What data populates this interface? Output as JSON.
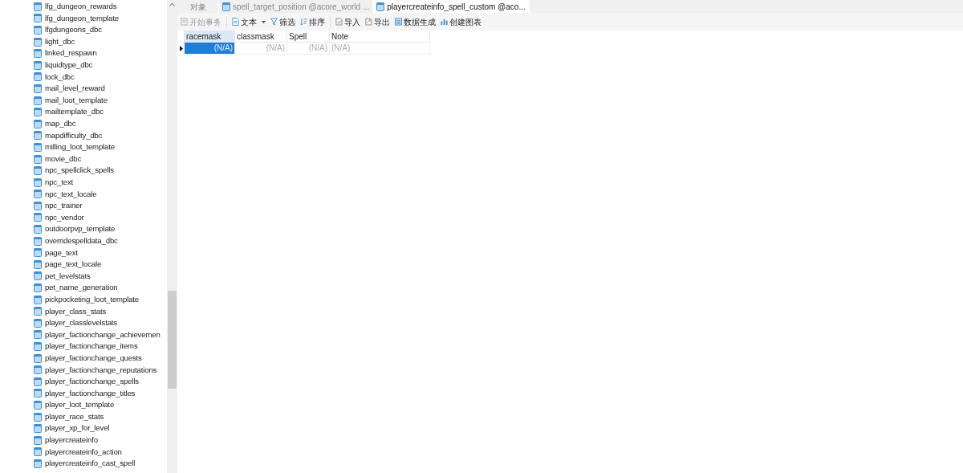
{
  "sidebar": {
    "items": [
      {
        "label": "lfg_dungeon_rewards"
      },
      {
        "label": "lfg_dungeon_template"
      },
      {
        "label": "lfgdungeons_dbc"
      },
      {
        "label": "light_dbc"
      },
      {
        "label": "linked_respawn"
      },
      {
        "label": "liquidtype_dbc"
      },
      {
        "label": "lock_dbc"
      },
      {
        "label": "mail_level_reward"
      },
      {
        "label": "mail_loot_template"
      },
      {
        "label": "mailtemplate_dbc"
      },
      {
        "label": "map_dbc"
      },
      {
        "label": "mapdifficulty_dbc"
      },
      {
        "label": "milling_loot_template"
      },
      {
        "label": "movie_dbc"
      },
      {
        "label": "npc_spellclick_spells"
      },
      {
        "label": "npc_text"
      },
      {
        "label": "npc_text_locale"
      },
      {
        "label": "npc_trainer"
      },
      {
        "label": "npc_vendor"
      },
      {
        "label": "outdoorpvp_template"
      },
      {
        "label": "overridespelldata_dbc"
      },
      {
        "label": "page_text"
      },
      {
        "label": "page_text_locale"
      },
      {
        "label": "pet_levelstats"
      },
      {
        "label": "pet_name_generation"
      },
      {
        "label": "pickpocketing_loot_template"
      },
      {
        "label": "player_class_stats"
      },
      {
        "label": "player_classlevelstats"
      },
      {
        "label": "player_factionchange_achievemen"
      },
      {
        "label": "player_factionchange_items"
      },
      {
        "label": "player_factionchange_quests"
      },
      {
        "label": "player_factionchange_reputations"
      },
      {
        "label": "player_factionchange_spells"
      },
      {
        "label": "player_factionchange_titles"
      },
      {
        "label": "player_loot_template"
      },
      {
        "label": "player_race_stats"
      },
      {
        "label": "player_xp_for_level"
      },
      {
        "label": "playercreateinfo"
      },
      {
        "label": "playercreateinfo_action"
      },
      {
        "label": "playercreateinfo_cast_spell"
      }
    ]
  },
  "tabs": [
    {
      "label": "对象",
      "kind": "plain",
      "selected": false
    },
    {
      "label": "spell_target_position @acore_world ...",
      "kind": "table",
      "selected": false
    },
    {
      "label": "playercreateinfo_spell_custom @aco...",
      "kind": "table",
      "selected": true
    }
  ],
  "toolbar": [
    {
      "label": "开始事务",
      "disabled": true
    },
    {
      "label": "文本",
      "dropdown": true,
      "disabled": false
    },
    {
      "label": "筛选",
      "disabled": false
    },
    {
      "label": "排序",
      "disabled": false
    },
    {
      "label": "导入",
      "disabled": false
    },
    {
      "label": "导出",
      "disabled": false
    },
    {
      "label": "数据生成",
      "disabled": false
    },
    {
      "label": "创建图表",
      "disabled": false
    }
  ],
  "table": {
    "columns": [
      "racemask",
      "classmask",
      "Spell",
      "Note"
    ],
    "rows": [
      {
        "current": true,
        "cells": [
          {
            "value": "(N/A)",
            "selected": true
          },
          {
            "value": "(N/A)",
            "selected": false
          },
          {
            "value": "(N/A)",
            "selected": false
          },
          {
            "value": "(N/A)",
            "selected": false
          }
        ]
      }
    ]
  }
}
